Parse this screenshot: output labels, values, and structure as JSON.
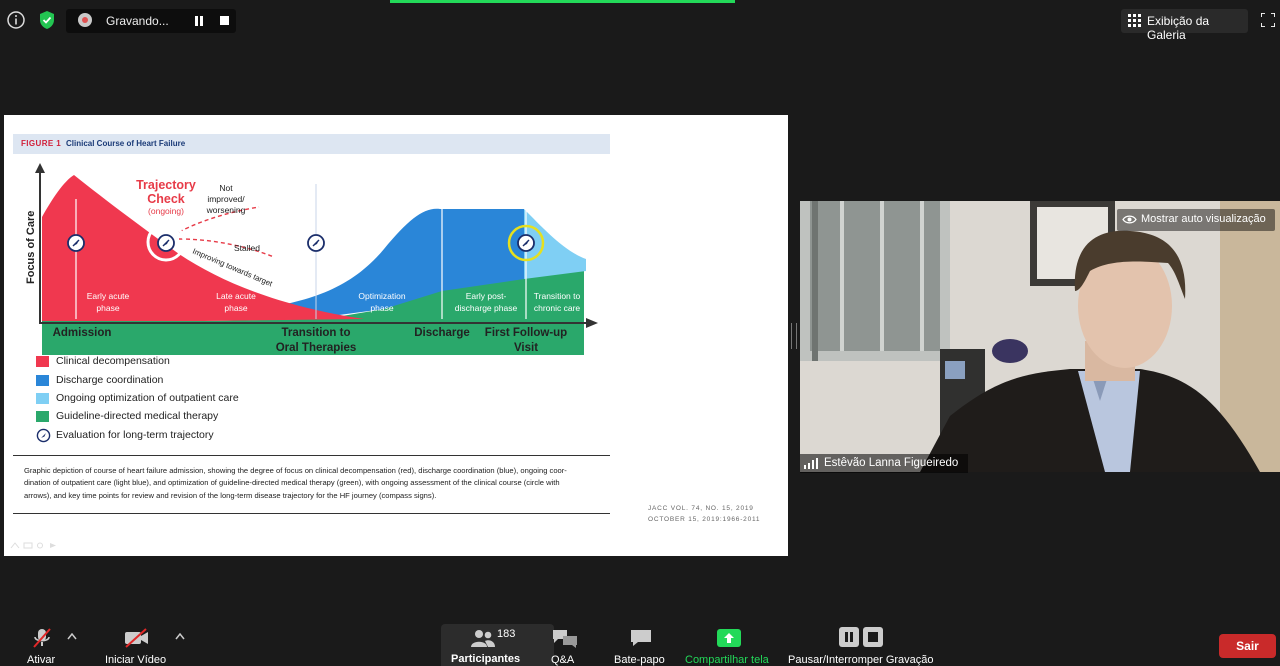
{
  "topbar": {
    "recording_label": "Gravando...",
    "gallery_view_label": "Exibição da Galeria"
  },
  "slide": {
    "figure_number": "FIGURE 1",
    "figure_title": "Clinical Course of Heart Failure",
    "chart": {
      "y_axis_label": "Focus of Care",
      "trajectory_title_1": "Trajectory",
      "trajectory_title_2": "Check",
      "trajectory_sub": "(ongoing)",
      "not_improved_1": "Not",
      "not_improved_2": "improved/",
      "not_improved_3": "worsening",
      "stalled": "Stalled",
      "improving": "Improving towards target",
      "phases": {
        "early_acute_1": "Early acute",
        "early_acute_2": "phase",
        "late_acute_1": "Late acute",
        "late_acute_2": "phase",
        "optimization_1": "Optimization",
        "optimization_2": "phase",
        "early_post_1": "Early post-",
        "early_post_2": "discharge phase",
        "chronic_1": "Transition to",
        "chronic_2": "chronic care"
      },
      "milestones": {
        "admission": "Admission",
        "transition_1": "Transition to",
        "transition_2": "Oral Therapies",
        "discharge": "Discharge",
        "followup_1": "First Follow-up",
        "followup_2": "Visit"
      },
      "colors": {
        "clinical_decompensation": "#f0384f",
        "discharge_coordination": "#2a86d8",
        "outpatient_care": "#7fcff4",
        "gdmt": "#2aa86b",
        "trajectory_red": "#e73b48",
        "compass_ring": "#1b2e6b",
        "highlight_ring": "#e6e01e"
      }
    },
    "legend": [
      {
        "label": "Clinical decompensation",
        "color": "#f0384f"
      },
      {
        "label": "Discharge coordination",
        "color": "#2a86d8"
      },
      {
        "label": "Ongoing optimization of outpatient care",
        "color": "#7fcff4"
      },
      {
        "label": "Guideline-directed medical therapy",
        "color": "#2aa86b"
      },
      {
        "label": "Evaluation for long-term trajectory",
        "color": "compass-icon"
      }
    ],
    "caption": {
      "line1": "Graphic depiction of course of heart failure admission, showing the degree of focus on clinical decompensation (red), discharge coordination (blue), ongoing coor-",
      "line2": "dination of outpatient care (light blue), and optimization of guideline-directed medical therapy (green), with ongoing assessment of the clinical course (circle with",
      "line3": "arrows), and key time points for review and revision of the long-term disease trajectory for the HF journey (compass signs)."
    },
    "citation": {
      "line1": "JACC VOL. 74, NO. 15, 2019",
      "line2": "OCTOBER 15, 2019:1966-2011"
    }
  },
  "video": {
    "self_view_label": "Mostrar auto visualização",
    "participant_name": "Estêvão Lanna Figueiredo"
  },
  "toolbar": {
    "mute_label": "Ativar",
    "video_label": "Iniciar Vídeo",
    "participants_label": "Participantes",
    "participants_count": "183",
    "qa_label": "Q&A",
    "chat_label": "Bate-papo",
    "share_label": "Compartilhar tela",
    "recording_control_label": "Pausar/Interromper Gravação",
    "leave_label": "Sair",
    "share_color": "#23d959",
    "leave_color": "#c92a2a"
  }
}
